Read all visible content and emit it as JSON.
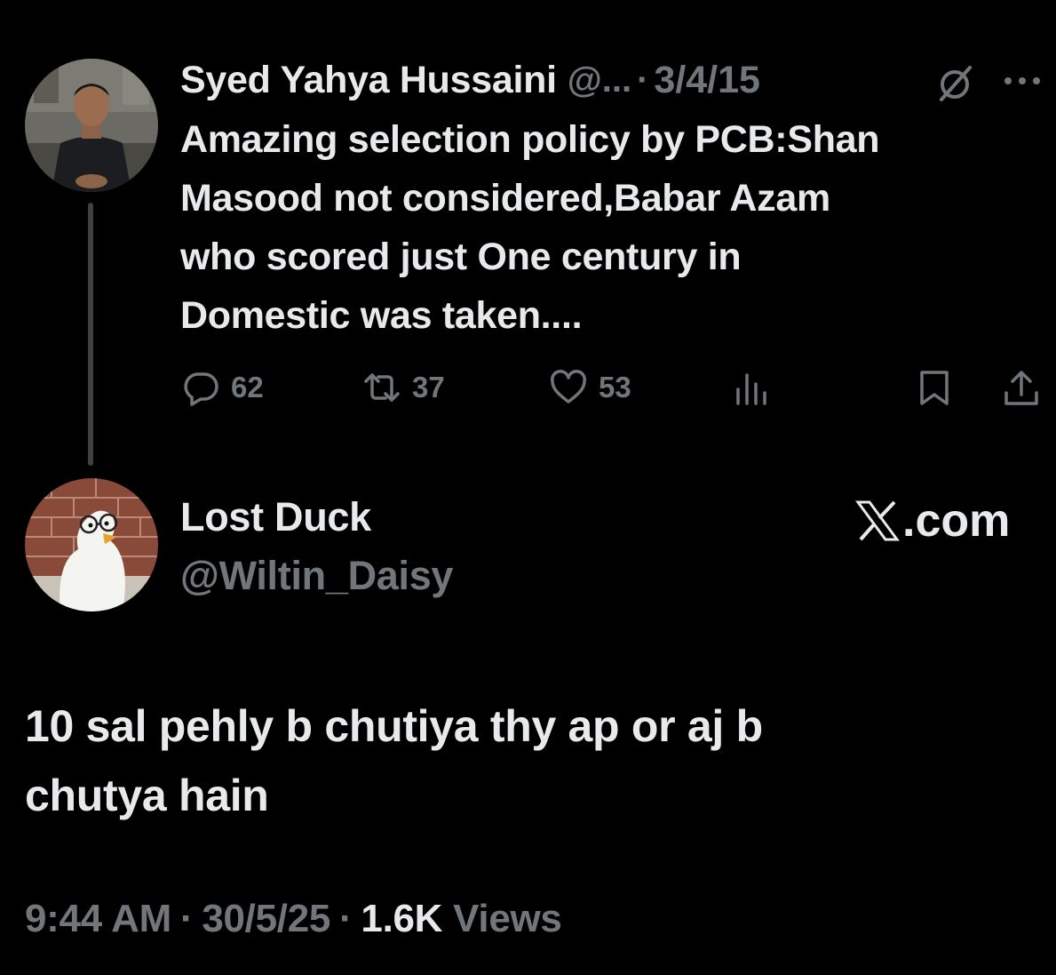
{
  "quoted_tweet": {
    "author_name": "Syed Yahya Hussaini",
    "author_handle": "@...",
    "separator": "·",
    "date": "3/4/15",
    "text_lines": [
      "Amazing selection policy by PCB:Shan",
      "Masood not considered,Babar Azam",
      "who scored just One century in",
      "Domestic was taken...."
    ],
    "actions": {
      "replies": "62",
      "retweets": "37",
      "likes": "53"
    },
    "icons": [
      "grok-icon",
      "more-icon",
      "reply-icon",
      "retweet-icon",
      "like-icon",
      "views-icon",
      "bookmark-icon",
      "share-icon"
    ]
  },
  "reply_tweet": {
    "author_name": "Lost Duck",
    "author_handle": "@Wiltin_Daisy",
    "brand": "𝕏.com",
    "brand_suffix": ".com",
    "text_lines": [
      "10 sal pehly b chutiya thy ap or aj b",
      "chutya hain"
    ],
    "time": "9:44 AM",
    "date": "30/5/25",
    "views_count": "1.6K",
    "views_label": "Views",
    "separator": "·"
  },
  "colors": {
    "background": "#000000",
    "primary_text": "#e7e9ea",
    "secondary_text": "#71767b",
    "thread_line": "#3e4144"
  }
}
